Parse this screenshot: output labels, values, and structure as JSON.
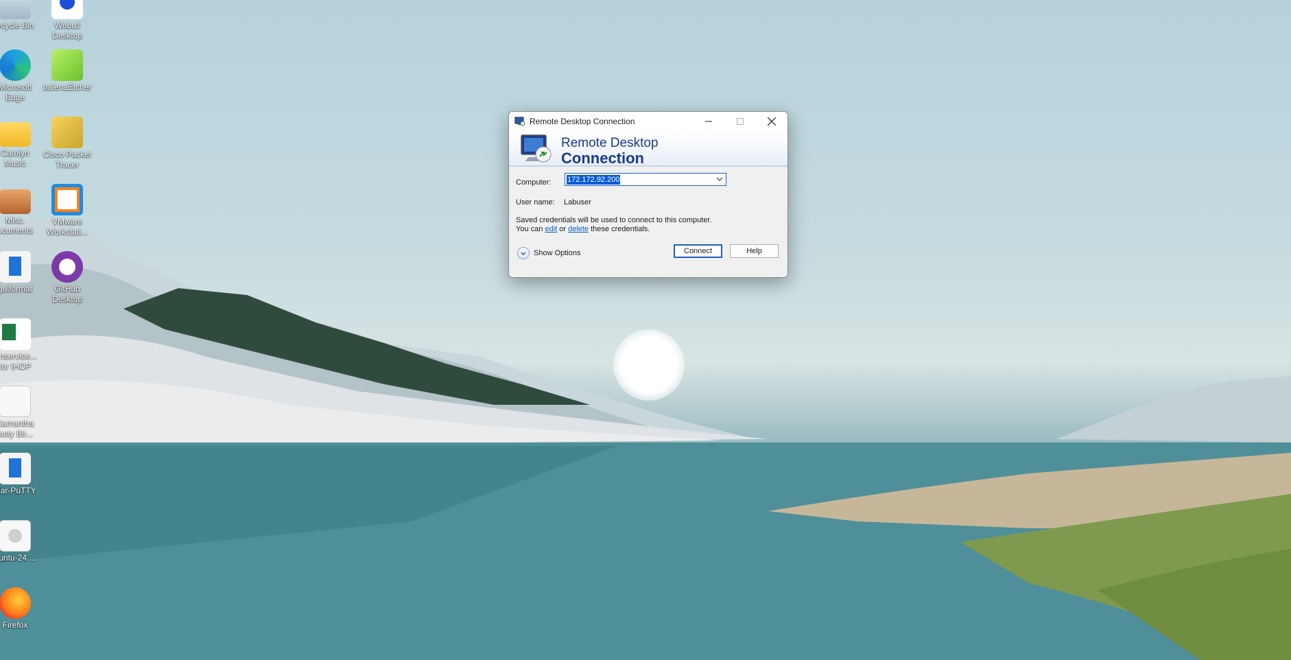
{
  "desktop": {
    "icons": [
      {
        "label": "ecycle Bin",
        "icon": "recycle-bin-icon"
      },
      {
        "label": "Webull\nDesktop",
        "icon": "webull-icon"
      },
      {
        "label": "Microsoft\nEdge",
        "icon": "edge-icon"
      },
      {
        "label": "balenaEtcher",
        "icon": "balena-etcher-icon"
      },
      {
        "label": "Carolyn\nMusic",
        "icon": "folder-icon"
      },
      {
        "label": "Cisco Packet\nTracer",
        "icon": "cisco-packet-tracer-icon"
      },
      {
        "label": "Misc.\nocuments",
        "icon": "folder-photo-icon"
      },
      {
        "label": "VMware\nWorkstati...",
        "icon": "vmware-icon"
      },
      {
        "label": "guiformat",
        "icon": "app-icon"
      },
      {
        "label": "GitHub\nDesktop",
        "icon": "github-icon"
      },
      {
        "label": "wnservice...\nfor IHOP",
        "icon": "excel-icon"
      },
      {
        "label": "Samantha\nlasty Bir...",
        "icon": "document-icon"
      },
      {
        "label": "olar-PuTTY",
        "icon": "putty-icon"
      },
      {
        "label": "buntu-24....",
        "icon": "disc-image-icon"
      },
      {
        "label": "Firefox",
        "icon": "firefox-icon"
      }
    ]
  },
  "dialog": {
    "title": "Remote Desktop Connection",
    "banner_line1": "Remote Desktop",
    "banner_line2": "Connection",
    "computer_label": "Computer:",
    "computer_value": "172.172.92.200",
    "username_label": "User name:",
    "username_value": "Labuser",
    "saved_line1": "Saved credentials will be used to connect to this computer.",
    "saved_you_can": "You can",
    "edit_link": "edit",
    "or_text": "or",
    "delete_link": "delete",
    "these_credentials": "these credentials.",
    "show_options": "Show Options",
    "connect_button": "Connect",
    "help_button": "Help"
  },
  "colors": {
    "accent": "#1f5fbf",
    "banner_text": "#1c3b8a",
    "link": "#0b62c4"
  }
}
